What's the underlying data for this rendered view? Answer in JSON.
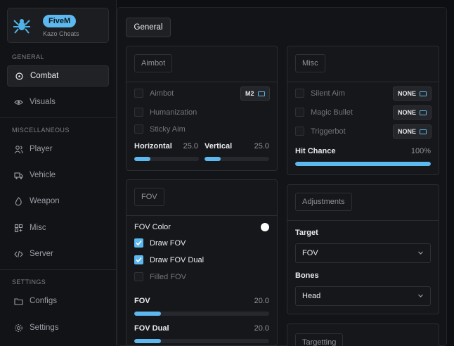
{
  "brand": {
    "badge": "FiveM",
    "subtitle": "Kazo Cheats"
  },
  "sidebar": {
    "sections": {
      "general": "GENERAL",
      "misc": "MISCELLANEOUS",
      "settings": "SETTINGS"
    },
    "items": [
      {
        "label": "Combat",
        "icon": "crosshair-icon"
      },
      {
        "label": "Visuals",
        "icon": "eye-icon"
      },
      {
        "label": "Player",
        "icon": "users-icon"
      },
      {
        "label": "Vehicle",
        "icon": "truck-icon"
      },
      {
        "label": "Weapon",
        "icon": "flame-icon"
      },
      {
        "label": "Misc",
        "icon": "grid-icon"
      },
      {
        "label": "Server",
        "icon": "code-icon"
      },
      {
        "label": "Configs",
        "icon": "folder-icon"
      },
      {
        "label": "Settings",
        "icon": "gear-icon"
      }
    ]
  },
  "tabs": {
    "general": "General"
  },
  "aimbot": {
    "title": "Aimbot",
    "aimbot_label": "Aimbot",
    "aimbot_key": "M2",
    "humanization_label": "Humanization",
    "sticky_label": "Sticky Aim",
    "horizontal": {
      "label": "Horizontal",
      "value": "25.0",
      "fraction": 0.25
    },
    "vertical": {
      "label": "Vertical",
      "value": "25.0",
      "fraction": 0.25
    }
  },
  "misc": {
    "title": "Misc",
    "silent_label": "Silent Aim",
    "silent_key": "NONE",
    "magic_label": "Magic Bullet",
    "magic_key": "NONE",
    "trigger_label": "Triggerbot",
    "trigger_key": "NONE",
    "hitchance": {
      "label": "Hit Chance",
      "value": "100%",
      "fraction": 1.0
    }
  },
  "fov": {
    "title": "FOV",
    "color_label": "FOV Color",
    "draw_label": "Draw FOV",
    "dual_label": "Draw FOV Dual",
    "filled_label": "Filled FOV",
    "fov_slider": {
      "label": "FOV",
      "value": "20.0",
      "fraction": 0.2
    },
    "dual_slider": {
      "label": "FOV Dual",
      "value": "20.0",
      "fraction": 0.2
    }
  },
  "adjustments": {
    "title": "Adjustments",
    "target_label": "Target",
    "target_value": "FOV",
    "bones_label": "Bones",
    "bones_value": "Head"
  },
  "targetting": {
    "title": "Targetting"
  },
  "colors": {
    "accent": "#5cb8ee"
  }
}
